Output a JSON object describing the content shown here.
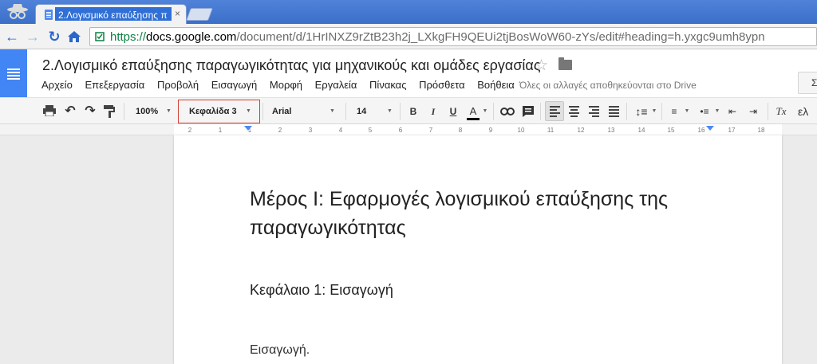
{
  "browser": {
    "tab": {
      "title": "2.Λογισμικό επαύξησης π",
      "close_icon": "×"
    },
    "url": {
      "scheme": "https://",
      "host": "docs.google.com",
      "path": "/document/d/1HrINXZ9rZtB23h2j_LXkgFH9QEUi2tjBosWoW60-zYs/edit#heading=h.yxgc9umh8ypn"
    }
  },
  "docs": {
    "title": "2.Λογισμικό επαύξησης παραγωγικότητας για μηχανικούς και ομάδες εργασίας",
    "menu": [
      "Αρχείο",
      "Επεξεργασία",
      "Προβολή",
      "Εισαγωγή",
      "Μορφή",
      "Εργαλεία",
      "Πίνακας",
      "Πρόσθετα",
      "Βοήθεια"
    ],
    "save_status": "Όλες οι αλλαγές αποθηκεύονται στο Drive",
    "share_label": "Σ"
  },
  "toolbar": {
    "zoom": "100%",
    "style": "Κεφαλίδα 3",
    "font": "Arial",
    "size": "14",
    "bold": "B",
    "italic": "I",
    "underline": "U",
    "text_color": "A",
    "clear_format": "Tx",
    "input_tools": "ελ"
  },
  "ruler": {
    "ticks": [
      "2",
      "1",
      "1",
      "2",
      "3",
      "4",
      "5",
      "6",
      "7",
      "8",
      "9",
      "10",
      "11",
      "12",
      "13",
      "14",
      "15",
      "16",
      "17",
      "18"
    ]
  },
  "document": {
    "heading1": "Μέρος Ι: Εφαρμογές λογισμικού επαύξησης της παραγωγικότητας",
    "heading2": "Κεφάλαιο 1: Εισαγωγή",
    "paragraph": "Εισαγωγή."
  },
  "colors": {
    "chrome_blue": "#3c6fc8",
    "docs_blue": "#4285f4",
    "highlight_red": "#d23f31",
    "url_green": "#0b8043"
  }
}
